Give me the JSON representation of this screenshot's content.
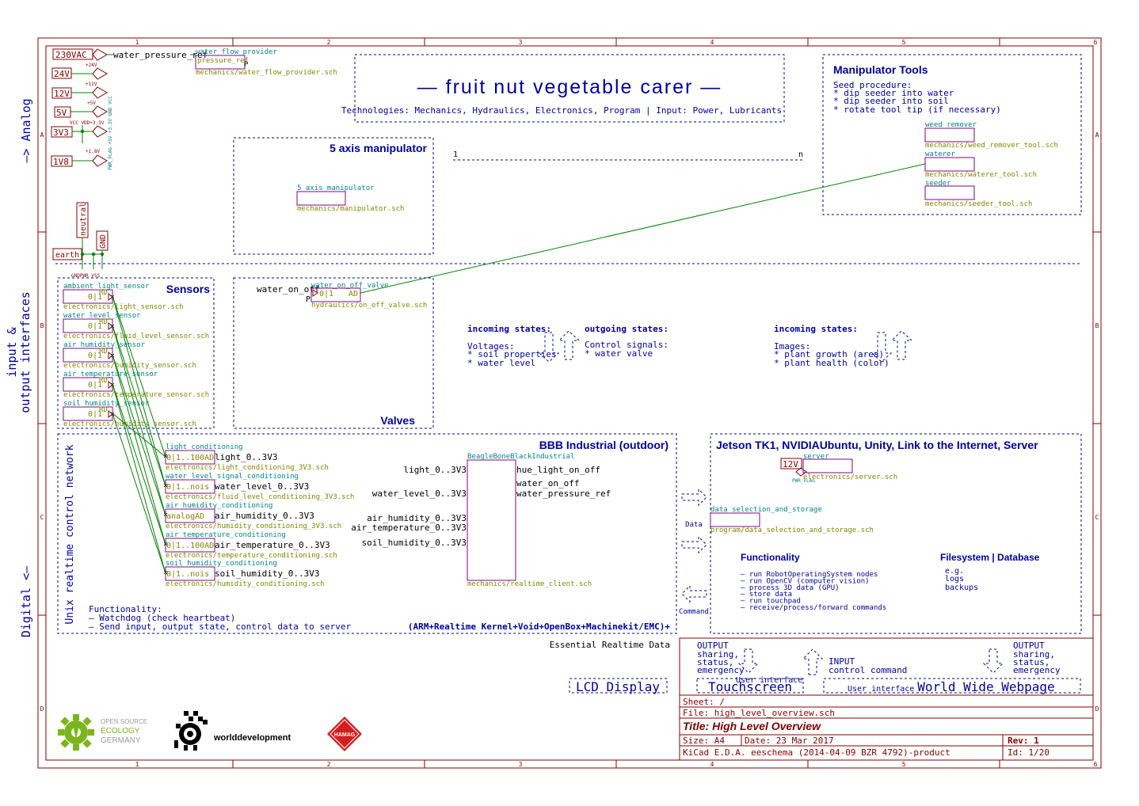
{
  "frame": {
    "col_numbers": [
      "1",
      "2",
      "3",
      "4",
      "5",
      "6"
    ],
    "row_letters": [
      "A",
      "B",
      "C",
      "D"
    ]
  },
  "side_labels": {
    "analog": "—> Analog",
    "io_line1": "input &",
    "io_line2": "output interfaces",
    "digital": "Digital <—",
    "unix": "Unix realtime control network"
  },
  "power": {
    "flags": [
      "230VAC",
      "24V",
      "12V",
      "5V",
      "3V3",
      "1V8"
    ],
    "vert_labels": "PWR_FLAG +5V +3.3V GND VCC",
    "rail_labels": [
      "+24V",
      "+12V",
      "+5V",
      "VCC VDD+3.3V",
      "+1.8V"
    ],
    "neutral": "neutral",
    "gnd": "GND",
    "earth": "earth",
    "gnd_small": "GNDPWR VSS",
    "water_pressure_ref": "water_pressure_ref",
    "wf_title": "water flow provider",
    "wf_pin": "pressure_ref",
    "wf_file": "mechanics/water_flow_provider.sch"
  },
  "banner": {
    "title": "— fruit nut vegetable carer —",
    "technologies": "Technologies: Mechanics, Hydraulics, Electronics, Program | Input: Power, Lubricants"
  },
  "manipulator": {
    "heading": "5 axis manipulator",
    "sheet_name": "5 axis manipulator",
    "sheet_file": "mechanics/manipulator.sch",
    "bus_start": "1",
    "bus_end": "n"
  },
  "tools": {
    "heading": "Manipulator Tools",
    "lines": [
      "Seed procedure:",
      "* dip seeder into water",
      "* dip seeder into soil",
      "* rotate tool tip (if necessary)"
    ],
    "sheets": [
      {
        "name": "weed_remover",
        "file": "mechanics/weed_remover_tool.sch"
      },
      {
        "name": "waterer",
        "file": "mechanics/waterer_tool.sch"
      },
      {
        "name": "seeder",
        "file": "mechanics/seeder_tool.sch"
      }
    ]
  },
  "sensors": {
    "heading": "Sensors",
    "items": [
      {
        "name": "ambient_light_sensor",
        "file": "electronics/light_sensor.sch"
      },
      {
        "name": "water_level_sensor",
        "file": "electronics/fluid_level_sensor.sch"
      },
      {
        "name": "air_humidity_sensor",
        "file": "electronics/humidity_sensor.sch"
      },
      {
        "name": "air_temperature_sensor",
        "file": "electronics/temperature_sensor.sch"
      },
      {
        "name": "soil_humidity_sensor",
        "file": "electronics/humidity_sensor.sch"
      }
    ],
    "pin_text": "0|1",
    "rd": "RD"
  },
  "valves": {
    "heading": "Valves",
    "label": "water_on_off",
    "p": "P",
    "sheet_name": "water_on_off_valve",
    "pin_text": "0|1",
    "ad": "AD",
    "file": "hydraulics/on_off_valve.sch"
  },
  "states": {
    "incoming1_title": "incoming states:",
    "incoming1_lines": [
      "Voltages:",
      "* soil properties",
      "* water level"
    ],
    "outgoing_title": "outgoing states:",
    "outgoing_lines": [
      "Control signals:",
      "* water valve"
    ],
    "incoming2_title": "incoming states:",
    "incoming2_lines": [
      "Images:",
      "* plant growth (area)",
      "* plant health (color)"
    ]
  },
  "bbb": {
    "heading": "BBB Industrial (outdoor)",
    "footer": "(ARM+Realtime Kernel+Void+OpenBox+Machinekit/EMC)+",
    "functionality": [
      "Functionality:",
      "— Watchdog (check heartbeat)",
      "— Send input, output state, control data to server"
    ],
    "conditioning": [
      {
        "name": "light_conditioning",
        "pin": "0|1..100AD",
        "out": "light_0..3V3",
        "file": "electronics/light_conditioning_3V3.sch"
      },
      {
        "name": "water_level_signal_conditioning",
        "pin": "0|1..nois",
        "out": "water_level_0..3V3",
        "file": "electronics/fluid_level_conditioning_3V3.sch"
      },
      {
        "name": "air_humidity_conditioning",
        "pin": "analogAD",
        "out": "air_humidity_0..3V3",
        "file": "electronics/humidity_conditioning_3V3.sch"
      },
      {
        "name": "air_temperature_conditioning",
        "pin": "0|1..100AD",
        "out": "air_temperature_0..3V3",
        "file": "electronics/temperature_conditioning.sch"
      },
      {
        "name": "soil_humidity_conditioning",
        "pin": "0|1..nois",
        "out": "soil_humidity_0..3V3",
        "file": "electronics/humidity_conditioning.sch"
      }
    ],
    "board_name": "BeagleBoneBlackIndustrial",
    "board_file": "mechanics/realtime_client.sch",
    "inputs": [
      "light_0..3V3",
      "water_level_0..3V3",
      "air_humidity_0..3V3",
      "air_temperature_0..3V3",
      "soil_humidity_0..3V3"
    ],
    "outputs": [
      "hue_light_on_off",
      "water_on_off",
      "water_pressure_ref"
    ]
  },
  "transfer": {
    "data": "Data",
    "command": "Command"
  },
  "jetson": {
    "heading": "Jetson TK1, NVIDIAUbuntu, Unity, Link to the Internet, Server",
    "flag12": "12V",
    "pwr": "PWR_FLAG",
    "server_name": "server",
    "server_file": "electronics/server.sch",
    "dss_name": "data_selection_and_storage",
    "dss_file": "program/data_selection_and_storage.sch",
    "func_title": "Functionality",
    "func_lines": [
      "– run RobotOperatingSystem nodes",
      "– run OpenCV (computer vision)",
      "– process 3D data (GPU)",
      "– store data",
      "– run touchpad",
      "– receive/process/forward commands"
    ],
    "fs_title": "Filesystem | Database",
    "fs_lines": [
      "e.g.",
      "logs",
      "backups"
    ]
  },
  "ui": {
    "essential": "Essential Realtime Data",
    "lcd": "LCD Display",
    "output1": [
      "OUTPUT",
      "sharing,",
      "status,",
      "emergency"
    ],
    "ui_label1": "User interface",
    "touchscreen": "Touchscreen",
    "input": [
      "INPUT",
      "control command"
    ],
    "ui_label2": "User interface",
    "www": "World Wide Webpage",
    "output2": [
      "OUTPUT",
      "sharing,",
      "status,",
      "emergency"
    ]
  },
  "logos": {
    "ose1": "OPEN SOURCE",
    "ose2": "ECOLOGY",
    "ose3": "GERMANY",
    "wd": "worlddevelopment",
    "hamag": "HAMAG"
  },
  "titleblock": {
    "sheet": "Sheet: /",
    "file": "File: high_level_overview.sch",
    "title": "Title: High Level Overview",
    "size": "Size: A4",
    "date": "Date: 23 Mar 2017",
    "rev": "Rev: 1",
    "kicad": "KiCad E.D.A.  eeschema (2014-04-09 BZR 4792)-product",
    "id": "Id: 1/20"
  },
  "colors": {
    "frame": "#840000",
    "label": "#0000a0",
    "sheet_name": "#008484",
    "sheet_file": "#848400",
    "wire": "#008400",
    "sheet_border": "#840084"
  }
}
